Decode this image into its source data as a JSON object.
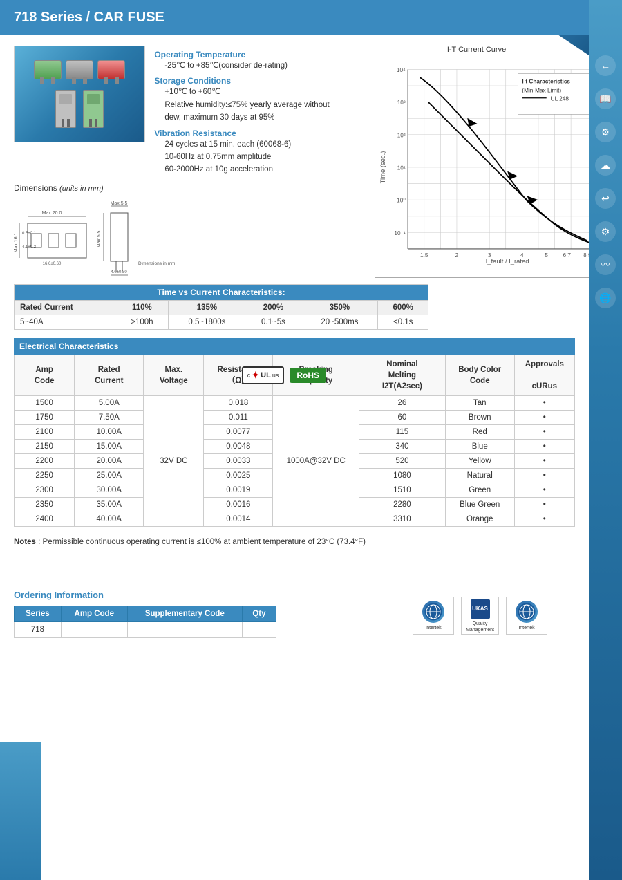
{
  "header": {
    "title": "718 Series / CAR FUSE"
  },
  "specs": {
    "operating_temp_label": "Operating Temperature",
    "operating_temp_value": "-25℃ to +85℃(consider de-rating)",
    "storage_label": "Storage Conditions",
    "storage_line1": "+10℃ to +60℃",
    "storage_line2": "Relative humidity:≤75% yearly average without dew, maximum 30 days at 95%",
    "vibration_label": "Vibration Resistance",
    "vibration_line1": "24 cycles at 15 min. each (60068-6)",
    "vibration_line2": "10-60Hz at 0.75mm amplitude",
    "vibration_line3": "60-2000Hz at 10g acceleration"
  },
  "dimensions": {
    "title": "Dimensions",
    "units": "(units in mm)"
  },
  "chart": {
    "title": "I-T Current Curve",
    "legend1": "I-t Characteristics",
    "legend2": "(Min-Max Limit)",
    "legend3": "UL 248",
    "x_label": "I_fault / I_rated",
    "y_label": "Time (sec.)"
  },
  "tvc_table": {
    "section_title": "Time vs Current Characteristics:",
    "headers": [
      "Rated Current",
      "110%",
      "135%",
      "200%",
      "350%",
      "600%"
    ],
    "row": [
      "5~40A",
      ">100h",
      "0.5~1800s",
      "0.1~5s",
      "20~500ms",
      "<0.1s"
    ]
  },
  "elec_table": {
    "section_title": "Electrical Characteristics",
    "headers": {
      "amp_code": "Amp\nCode",
      "rated_current": "Rated\nCurrent",
      "max_voltage": "Max.\nVoltage",
      "resistance": "Resistance\n（Ω）",
      "breaking_capacity": "Breaking\nCapacity",
      "nominal_melting": "Nominal\nMelting\nI2T(A2sec)",
      "body_color": "Body Color\nCode",
      "approvals": "Approvals\n\ncURus"
    },
    "rows": [
      {
        "amp_code": "1500",
        "rated_current": "5.00A",
        "max_voltage": "",
        "resistance": "0.018",
        "breaking_capacity": "",
        "nominal_melting": "26",
        "body_color": "Tan",
        "approvals": "•"
      },
      {
        "amp_code": "1750",
        "rated_current": "7.50A",
        "max_voltage": "",
        "resistance": "0.011",
        "breaking_capacity": "",
        "nominal_melting": "60",
        "body_color": "Brown",
        "approvals": "•"
      },
      {
        "amp_code": "2100",
        "rated_current": "10.00A",
        "max_voltage": "",
        "resistance": "0.0077",
        "breaking_capacity": "",
        "nominal_melting": "115",
        "body_color": "Red",
        "approvals": "•"
      },
      {
        "amp_code": "2150",
        "rated_current": "15.00A",
        "max_voltage": "",
        "resistance": "0.0048",
        "breaking_capacity": "",
        "nominal_melting": "340",
        "body_color": "Blue",
        "approvals": "•"
      },
      {
        "amp_code": "2200",
        "rated_current": "20.00A",
        "max_voltage": "32V DC",
        "resistance": "0.0033",
        "breaking_capacity": "1000A@32V DC",
        "nominal_melting": "520",
        "body_color": "Yellow",
        "approvals": "•"
      },
      {
        "amp_code": "2250",
        "rated_current": "25.00A",
        "max_voltage": "",
        "resistance": "0.0025",
        "breaking_capacity": "",
        "nominal_melting": "1080",
        "body_color": "Natural",
        "approvals": "•"
      },
      {
        "amp_code": "2300",
        "rated_current": "30.00A",
        "max_voltage": "",
        "resistance": "0.0019",
        "breaking_capacity": "",
        "nominal_melting": "1510",
        "body_color": "Green",
        "approvals": "•"
      },
      {
        "amp_code": "2350",
        "rated_current": "35.00A",
        "max_voltage": "",
        "resistance": "0.0016",
        "breaking_capacity": "",
        "nominal_melting": "2280",
        "body_color": "Blue Green",
        "approvals": "•"
      },
      {
        "amp_code": "2400",
        "rated_current": "40.00A",
        "max_voltage": "",
        "resistance": "0.0014",
        "breaking_capacity": "",
        "nominal_melting": "3310",
        "body_color": "Orange",
        "approvals": "•"
      }
    ]
  },
  "notes": {
    "label": "Notes",
    "text": ": Permissible continuous operating current is ≤100% at ambient temperature of 23°C (73.4°F)"
  },
  "ordering": {
    "title": "Ordering Information",
    "headers": [
      "Series",
      "Amp Code",
      "Supplementary Code",
      "Qty"
    ],
    "row": [
      "718",
      "",
      "",
      ""
    ]
  },
  "logos": [
    {
      "name": "Intertek",
      "symbol": "♻"
    },
    {
      "name": "UKAS",
      "symbol": "✓"
    },
    {
      "name": "Intertek",
      "symbol": "♻"
    }
  ],
  "sidebar_icons": [
    "←",
    "📖",
    "⚙",
    "☁",
    "↩",
    "⚙",
    "〰",
    "🌐"
  ]
}
